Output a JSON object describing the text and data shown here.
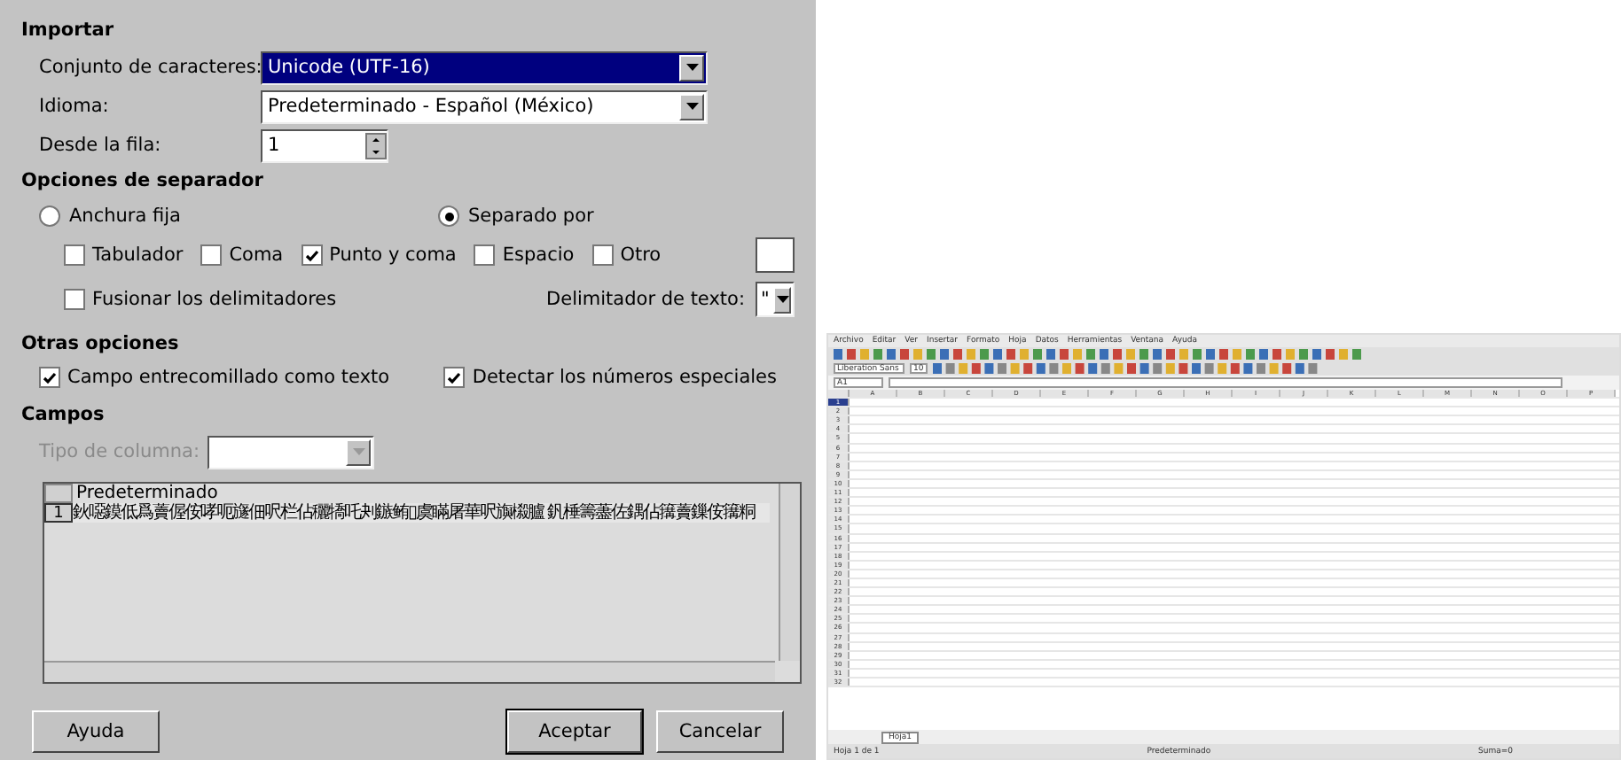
{
  "dialog": {
    "import": {
      "title": "Importar",
      "charset": {
        "label": "Conjunto de caracteres:",
        "value": "Unicode (UTF-16)",
        "focused": true
      },
      "language": {
        "label": "Idioma:",
        "value": "Predeterminado - Español (México)"
      },
      "from_row": {
        "label": "Desde la fila:",
        "value": "1"
      }
    },
    "separator": {
      "title": "Opciones de separador",
      "modes": [
        {
          "label": "Anchura fija",
          "selected": false
        },
        {
          "label": "Separado por",
          "selected": true
        }
      ],
      "options": [
        {
          "label": "Tabulador",
          "checked": false
        },
        {
          "label": "Coma",
          "checked": false
        },
        {
          "label": "Punto y coma",
          "checked": true
        },
        {
          "label": "Espacio",
          "checked": false
        },
        {
          "label": "Otro",
          "checked": false
        }
      ],
      "merge": {
        "label": "Fusionar los delimitadores",
        "checked": false
      },
      "text_delimiter": {
        "label": "Delimitador de texto:",
        "value": "\""
      }
    },
    "other": {
      "title": "Otras opciones",
      "options": [
        {
          "label": "Campo entrecomillado como texto",
          "checked": true
        },
        {
          "label": "Detectar los números especiales",
          "checked": true
        }
      ]
    },
    "fields": {
      "title": "Campos",
      "column_type": {
        "label": "Tipo de columna:",
        "disabled": true
      },
      "header": "Predeterminado",
      "rows": [
        {
          "number": "1",
          "text": "鈥噁鏌低爲藚偓侒哮呃旞佃呎栏佔穲犞吒刔鏃鲔▯虞瞞屠華呎旟榝臚 釩棰籌藎佐鍝佔簼藚鏁侒簼粡"
        }
      ]
    },
    "buttons": [
      {
        "label": "Ayuda",
        "kind": "help"
      },
      {
        "label": "Aceptar",
        "kind": "default"
      },
      {
        "label": "Cancelar",
        "kind": "normal"
      }
    ]
  },
  "spreadsheet": {
    "menu": [
      "Archivo",
      "Editar",
      "Ver",
      "Insertar",
      "Formato",
      "Hoja",
      "Datos",
      "Herramientas",
      "Ventana",
      "Ayuda"
    ],
    "font_name": "Liberation Sans",
    "font_size": "10",
    "cell_ref": "A1",
    "columns": [
      "A",
      "B",
      "C",
      "D",
      "E",
      "F",
      "G",
      "H",
      "I",
      "J",
      "K",
      "L",
      "M",
      "N",
      "O",
      "P"
    ],
    "rows": [
      "1",
      "2",
      "3",
      "4",
      "5",
      "6",
      "7",
      "8",
      "9",
      "10",
      "11",
      "12",
      "13",
      "14",
      "15",
      "16",
      "17",
      "18",
      "19",
      "20",
      "21",
      "22",
      "23",
      "24",
      "25",
      "26",
      "27",
      "28",
      "29",
      "30",
      "31",
      "32"
    ],
    "sheet_tab": "Hoja1",
    "status": [
      "Hoja 1 de 1",
      "Predeterminado",
      "Suma=0"
    ]
  }
}
